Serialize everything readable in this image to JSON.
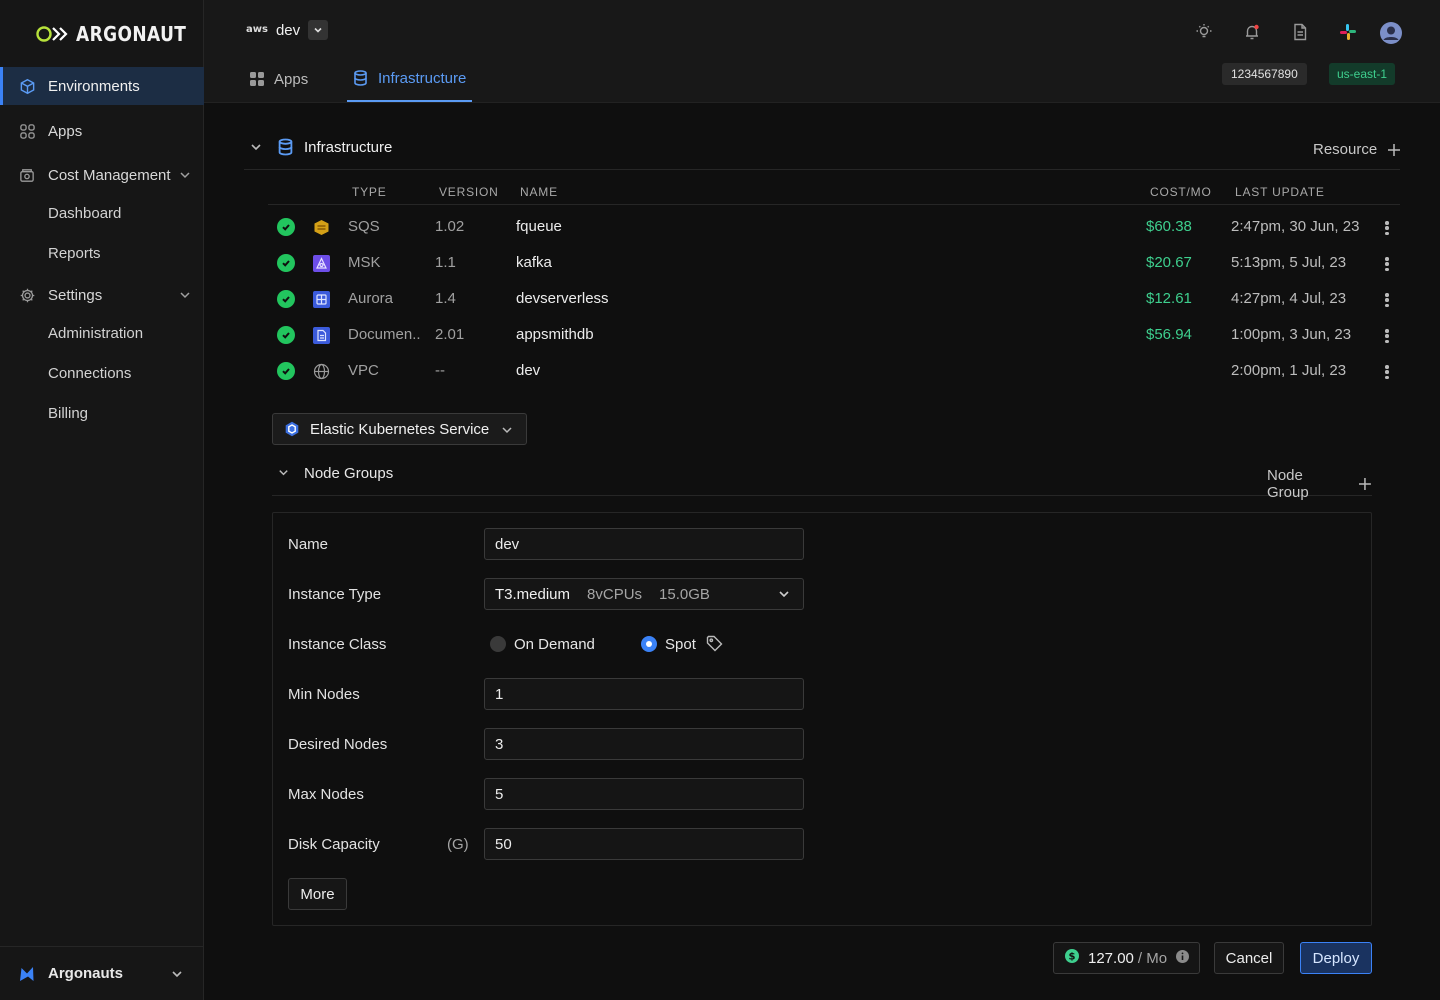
{
  "brand": {
    "name": "ARGONAUT"
  },
  "sidebar": {
    "items": [
      {
        "label": "Environments"
      },
      {
        "label": "Apps"
      },
      {
        "label": "Cost Management"
      },
      {
        "label": "Settings"
      }
    ],
    "cost_sub": [
      "Dashboard",
      "Reports"
    ],
    "settings_sub": [
      "Administration",
      "Connections",
      "Billing"
    ],
    "org": "Argonauts"
  },
  "header": {
    "cloud": "aws",
    "env": "dev",
    "tabs": [
      {
        "label": "Apps"
      },
      {
        "label": "Infrastructure"
      }
    ],
    "account_id": "1234567890",
    "region": "us-east-1"
  },
  "infra": {
    "title": "Infrastructure",
    "add_label": "Resource",
    "columns": [
      "TYPE",
      "VERSION",
      "NAME",
      "COST/MO",
      "LAST UPDATE"
    ],
    "rows": [
      {
        "type": "SQS",
        "version": "1.02",
        "name": "fqueue",
        "cost": "$60.38",
        "updated": "2:47pm, 30 Jun, 23",
        "icon": "sqs-icon",
        "color": "#d4a017"
      },
      {
        "type": "MSK",
        "version": "1.1",
        "name": "kafka",
        "cost": "$20.67",
        "updated": "5:13pm, 5 Jul, 23",
        "icon": "msk-icon",
        "color": "#6d4ee8"
      },
      {
        "type": "Aurora",
        "version": "1.4",
        "name": "devserverless",
        "cost": "$12.61",
        "updated": "4:27pm, 4 Jul, 23",
        "icon": "aurora-icon",
        "color": "#3b5bdb"
      },
      {
        "type": "Documen..",
        "version": "2.01",
        "name": "appsmithdb",
        "cost": "$56.94",
        "updated": "1:00pm, 3 Jun, 23",
        "icon": "documentdb-icon",
        "color": "#3b5bdb"
      },
      {
        "type": "VPC",
        "version": "--",
        "name": "dev",
        "cost": "",
        "updated": "2:00pm, 1 Jul, 23",
        "icon": "globe-icon",
        "color": "#9a9a9a"
      }
    ]
  },
  "eks": {
    "label": "Elastic Kubernetes Service"
  },
  "node_groups": {
    "title": "Node Groups",
    "add_label": "Node Group",
    "form": {
      "name_label": "Name",
      "name_value": "dev",
      "instance_type_label": "Instance Type",
      "instance_type": "T3.medium",
      "instance_cpus": "8vCPUs",
      "instance_mem": "15.0GB",
      "instance_class_label": "Instance Class",
      "class_on_demand": "On Demand",
      "class_spot": "Spot",
      "selected_class": "Spot",
      "min_label": "Min Nodes",
      "min_value": "1",
      "desired_label": "Desired Nodes",
      "desired_value": "3",
      "max_label": "Max Nodes",
      "max_value": "5",
      "disk_label": "Disk Capacity",
      "disk_unit": "(G)",
      "disk_value": "50",
      "more_label": "More"
    }
  },
  "footer": {
    "cost_value": "127.00",
    "cost_unit": "/ Mo",
    "cancel_label": "Cancel",
    "deploy_label": "Deploy"
  },
  "colors": {
    "accent": "#3b82f6",
    "success": "#3ecf8e",
    "status_ok": "#22c55e"
  }
}
